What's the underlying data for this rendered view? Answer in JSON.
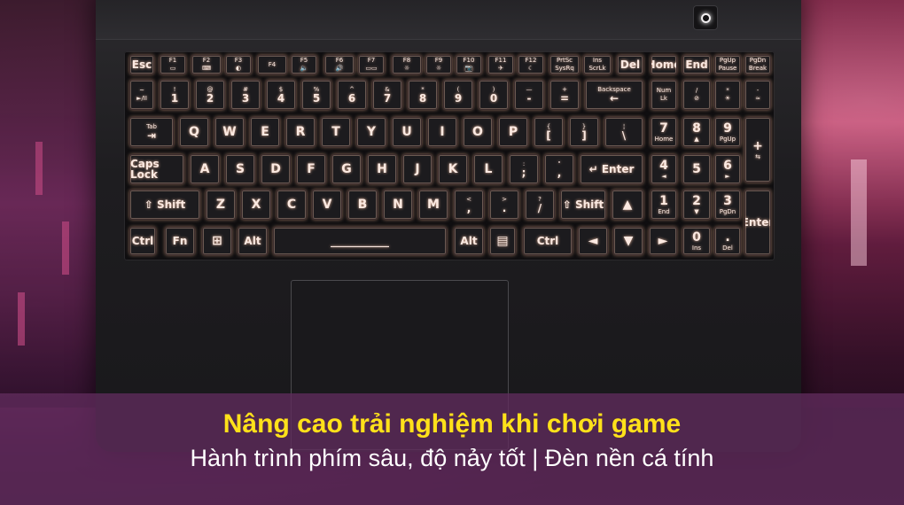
{
  "caption": {
    "title": "Nâng cao trải nghiệm khi chơi game",
    "subtitle": "Hành trình phím sâu, độ nảy tốt | Đèn nền cá tính"
  },
  "keyboard": {
    "rows": [
      [
        {
          "m": "Esc"
        },
        {
          "t": "F1",
          "b": "▭"
        },
        {
          "t": "F2",
          "b": "⌨"
        },
        {
          "t": "F3",
          "b": "◐"
        },
        {
          "t": "F4"
        },
        {
          "t": "F5",
          "b": "🔈"
        },
        {
          "t": "F6",
          "b": "🔊"
        },
        {
          "t": "F7",
          "b": "▭▭"
        },
        {
          "t": "F8",
          "b": "☼"
        },
        {
          "t": "F9",
          "b": "☼"
        },
        {
          "t": "F10",
          "b": "📷"
        },
        {
          "t": "F11",
          "b": "✈"
        },
        {
          "t": "F12",
          "b": "☾"
        },
        {
          "t": "PrtSc",
          "b": "SysRq"
        },
        {
          "t": "Ins",
          "b": "ScrLk"
        },
        {
          "m": "Del"
        },
        {
          "m": "Home"
        },
        {
          "m": "End"
        },
        {
          "t": "PgUp",
          "b": "Pause"
        },
        {
          "t": "PgDn",
          "b": "Break"
        }
      ],
      [
        {
          "t": "~",
          "b": "►/II"
        },
        {
          "t": "!",
          "m": "1"
        },
        {
          "t": "@",
          "m": "2"
        },
        {
          "t": "#",
          "m": "3"
        },
        {
          "t": "$",
          "m": "4"
        },
        {
          "t": "%",
          "m": "5"
        },
        {
          "t": "^",
          "m": "6"
        },
        {
          "t": "&",
          "m": "7"
        },
        {
          "t": "*",
          "m": "8"
        },
        {
          "t": "(",
          "m": "9"
        },
        {
          "t": ")",
          "m": "0"
        },
        {
          "t": "—",
          "m": "-"
        },
        {
          "t": "+",
          "m": "="
        },
        {
          "t": "Backspace",
          "m": "←"
        },
        {
          "t": "Num",
          "b": "Lk"
        },
        {
          "t": "/",
          "b": "⊘"
        },
        {
          "t": "*",
          "b": "☀"
        },
        {
          "t": "-",
          "b": "≈"
        }
      ],
      [
        {
          "t": "Tab",
          "m": "⇥"
        },
        {
          "m": "Q"
        },
        {
          "m": "W"
        },
        {
          "m": "E"
        },
        {
          "m": "R"
        },
        {
          "m": "T"
        },
        {
          "m": "Y"
        },
        {
          "m": "U"
        },
        {
          "m": "I"
        },
        {
          "m": "O"
        },
        {
          "m": "P"
        },
        {
          "t": "{",
          "m": "["
        },
        {
          "t": "}",
          "m": "]"
        },
        {
          "t": "¦",
          "m": "\\"
        },
        {
          "m": "7",
          "b": "Home"
        },
        {
          "m": "8",
          "b": "▲"
        },
        {
          "m": "9",
          "b": "PgUp"
        },
        {
          "m": "+",
          "b": "⇆"
        }
      ],
      [
        {
          "m": "Caps Lock"
        },
        {
          "m": "A"
        },
        {
          "m": "S"
        },
        {
          "m": "D"
        },
        {
          "m": "F"
        },
        {
          "m": "G"
        },
        {
          "m": "H"
        },
        {
          "m": "J"
        },
        {
          "m": "K"
        },
        {
          "m": "L"
        },
        {
          "t": ":",
          "m": ";"
        },
        {
          "t": "\"",
          "m": ","
        },
        {
          "m": "↵ Enter"
        },
        {
          "m": "4",
          "b": "◄"
        },
        {
          "m": "5"
        },
        {
          "m": "6",
          "b": "►"
        }
      ],
      [
        {
          "m": "⇧ Shift"
        },
        {
          "m": "Z"
        },
        {
          "m": "X"
        },
        {
          "m": "C"
        },
        {
          "m": "V"
        },
        {
          "m": "B"
        },
        {
          "m": "N"
        },
        {
          "m": "M"
        },
        {
          "t": "<",
          "m": ","
        },
        {
          "t": ">",
          "m": "."
        },
        {
          "t": "?",
          "m": "/"
        },
        {
          "m": "⇧ Shift"
        },
        {
          "m": "▲"
        },
        {
          "m": "1",
          "b": "End"
        },
        {
          "m": "2",
          "b": "▼"
        },
        {
          "m": "3",
          "b": "PgDn"
        },
        {
          "m": "Enter"
        }
      ],
      [
        {
          "m": "Ctrl"
        },
        {
          "m": "Fn"
        },
        {
          "m": "⊞"
        },
        {
          "m": "Alt"
        },
        {
          "m": "___________"
        },
        {
          "m": "Alt"
        },
        {
          "m": "▤"
        },
        {
          "m": "Ctrl"
        },
        {
          "m": "◄"
        },
        {
          "m": "▼"
        },
        {
          "m": "►"
        },
        {
          "m": "0",
          "b": "Ins"
        },
        {
          "m": ".",
          "b": "Del"
        }
      ]
    ]
  }
}
